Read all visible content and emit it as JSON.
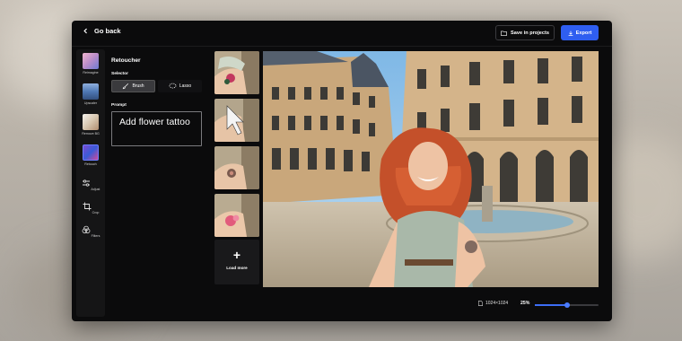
{
  "header": {
    "back_label": "Go back",
    "save_label": "Save in projects",
    "export_label": "Export"
  },
  "rail": {
    "items": [
      {
        "label": "Reimagine",
        "icon": "reimagine-thumb"
      },
      {
        "label": "Upscaler",
        "icon": "upscaler-thumb"
      },
      {
        "label": "Remove BG",
        "icon": "remove-bg-thumb"
      },
      {
        "label": "Retouch",
        "icon": "retouch-thumb",
        "active": true
      },
      {
        "label": "Adjust",
        "icon": "sliders-icon"
      },
      {
        "label": "Crop",
        "icon": "crop-icon"
      },
      {
        "label": "Filters",
        "icon": "filters-icon"
      }
    ]
  },
  "panel": {
    "title": "Retoucher",
    "selector_label": "Selector",
    "brush_label": "Brush",
    "lasso_label": "Lasso",
    "prompt_label": "Prompt",
    "prompt_value": "Add flower tattoo"
  },
  "variations": {
    "load_more_label": "Load more"
  },
  "footer": {
    "image_size": "1024×1024",
    "zoom_label": "25%",
    "zoom_fraction": 0.5
  },
  "colors": {
    "accent": "#2f5ef0",
    "background": "#0b0b0c"
  }
}
